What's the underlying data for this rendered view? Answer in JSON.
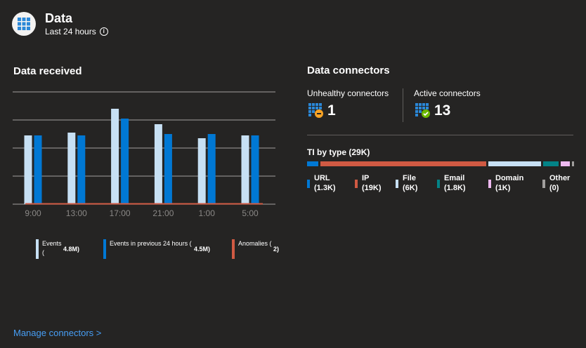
{
  "header": {
    "title": "Data",
    "subtitle": "Last 24 hours",
    "icon": "grid-icon"
  },
  "data_received": {
    "title": "Data received",
    "legend": [
      {
        "label": "Events (",
        "value": "4.8M)",
        "color": "#c7e0f4"
      },
      {
        "label": "Events in previous 24 hours (",
        "value": "4.5M)",
        "color": "#0078d4"
      },
      {
        "label": "Anomalies (",
        "value": "2)",
        "color": "#d05a43"
      }
    ]
  },
  "chart_data": {
    "type": "bar",
    "categories": [
      "9:00",
      "13:00",
      "17:00",
      "21:00",
      "1:00",
      "5:00"
    ],
    "series": [
      {
        "name": "Events",
        "values": [
          2.45,
          2.55,
          3.4,
          2.85,
          2.35,
          2.45
        ]
      },
      {
        "name": "Events in previous 24 hours",
        "values": [
          2.45,
          2.45,
          3.05,
          2.5,
          2.5,
          2.45
        ]
      },
      {
        "name": "Anomalies",
        "values": [
          0,
          0,
          0,
          0,
          0,
          0
        ]
      }
    ],
    "ylim": [
      0,
      4
    ],
    "grid": true,
    "legend_position": "bottom"
  },
  "manage_link": "Manage connectors >",
  "connectors": {
    "title": "Data connectors",
    "unhealthy": {
      "label": "Unhealthy connectors",
      "value": "1"
    },
    "active": {
      "label": "Active connectors",
      "value": "13"
    }
  },
  "ti_by_type": {
    "title": "TI by type (29K)",
    "items": [
      {
        "name": "URL",
        "value": "(1.3K)",
        "color": "#0078d4",
        "share": 1.3
      },
      {
        "name": "IP",
        "value": "(19K)",
        "color": "#d05a43",
        "share": 19
      },
      {
        "name": "File",
        "value": "(6K)",
        "color": "#c7e0f4",
        "share": 6
      },
      {
        "name": "Email",
        "value": "(1.8K)",
        "color": "#038387",
        "share": 1.8
      },
      {
        "name": "Domain",
        "value": "(1K)",
        "color": "#eeb9f0",
        "share": 1
      },
      {
        "name": "Other",
        "value": "(0)",
        "color": "#a19f9d",
        "share": 0.2
      }
    ]
  }
}
